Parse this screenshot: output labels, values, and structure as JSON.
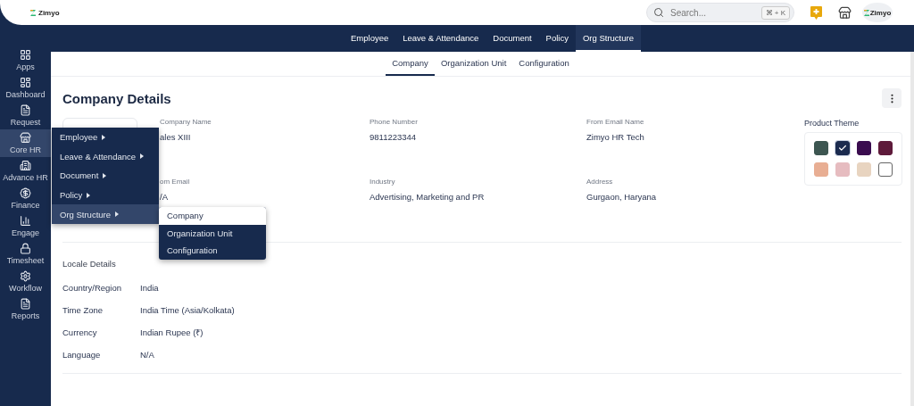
{
  "header": {
    "logo_text": "Zimyo",
    "search": {
      "placeholder": "Search...",
      "shortcut": "⌘ + K"
    },
    "avatar_text": "Zimyo"
  },
  "sidebar": {
    "items": [
      {
        "label": "Apps",
        "selected": false
      },
      {
        "label": "Dashboard",
        "selected": false
      },
      {
        "label": "Request",
        "selected": false
      },
      {
        "label": "Core HR",
        "selected": true
      },
      {
        "label": "Advance HR",
        "selected": false
      },
      {
        "label": "Finance",
        "selected": false
      },
      {
        "label": "Engage",
        "selected": false
      },
      {
        "label": "Timesheet",
        "selected": false
      },
      {
        "label": "Workflow",
        "selected": false
      },
      {
        "label": "Reports",
        "selected": false
      }
    ]
  },
  "top_tabs": [
    {
      "label": "Employee",
      "selected": false
    },
    {
      "label": "Leave & Attendance",
      "selected": false
    },
    {
      "label": "Document",
      "selected": false
    },
    {
      "label": "Policy",
      "selected": false
    },
    {
      "label": "Org Structure",
      "selected": true
    }
  ],
  "sub_tabs": [
    {
      "label": "Company",
      "selected": true
    },
    {
      "label": "Organization Unit",
      "selected": false
    },
    {
      "label": "Configuration",
      "selected": false
    }
  ],
  "page_title": "Company Details",
  "fields": [
    {
      "label": "Company Name",
      "value": "ales XIII"
    },
    {
      "label": "Phone Number",
      "value": "9811223344"
    },
    {
      "label": "From Email Name",
      "value": "Zimyo HR Tech"
    },
    {
      "label": "om Email",
      "value": "/A"
    },
    {
      "label": "Industry",
      "value": "Advertising, Marketing and PR"
    },
    {
      "label": "Address",
      "value": "Gurgaon, Haryana"
    }
  ],
  "product_theme": {
    "label": "Product Theme",
    "swatches": [
      {
        "color": "#3d5651",
        "selected": false
      },
      {
        "color": "#1b2b4f",
        "selected": true
      },
      {
        "color": "#3a0c4f",
        "selected": false
      },
      {
        "color": "#5e1a3a",
        "selected": false
      },
      {
        "color": "#e8ae93",
        "selected": false
      },
      {
        "color": "#e6bcc0",
        "selected": false
      },
      {
        "color": "#e8d4c0",
        "selected": false
      },
      {
        "color": "#ffffff",
        "selected": false
      }
    ]
  },
  "locale": {
    "title": "Locale Details",
    "rows": [
      {
        "label": "Country/Region",
        "value": "India"
      },
      {
        "label": "Time Zone",
        "value": "India Time (Asia/Kolkata)"
      },
      {
        "label": "Currency",
        "value": "Indian Rupee (₹)"
      },
      {
        "label": "Language",
        "value": "N/A"
      }
    ]
  },
  "flyout_menu": {
    "items": [
      {
        "label": "Employee",
        "selected": false
      },
      {
        "label": "Leave & Attendance",
        "selected": false
      },
      {
        "label": "Document",
        "selected": false
      },
      {
        "label": "Policy",
        "selected": false
      },
      {
        "label": "Org Structure",
        "selected": true
      }
    ],
    "submenu": [
      {
        "label": "Company",
        "selected": true
      },
      {
        "label": "Organization Unit",
        "selected": false
      },
      {
        "label": "Configuration",
        "selected": false
      }
    ]
  }
}
